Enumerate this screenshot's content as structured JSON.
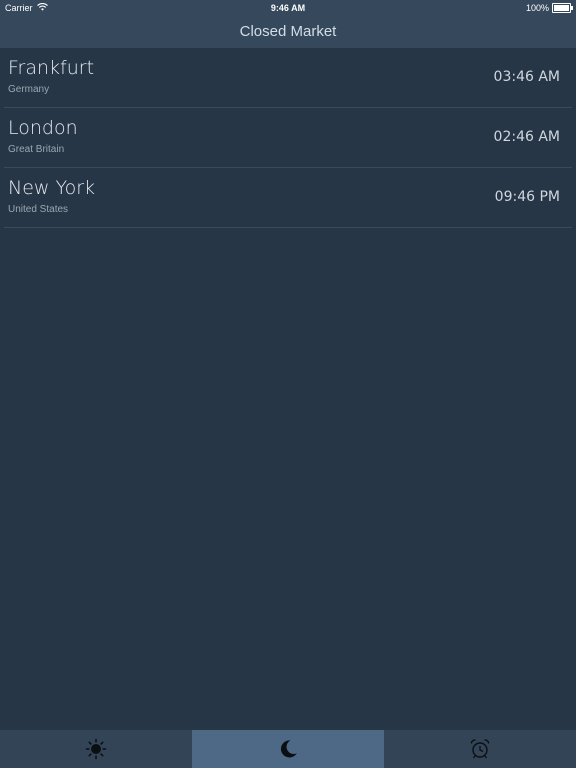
{
  "status_bar": {
    "carrier": "Carrier",
    "time": "9:46 AM",
    "battery_text": "100%"
  },
  "nav": {
    "title": "Closed Market"
  },
  "markets": [
    {
      "city": "Frankfurt",
      "country": "Germany",
      "time": "03:46 AM"
    },
    {
      "city": "London",
      "country": "Great Britain",
      "time": "02:46 AM"
    },
    {
      "city": "New York",
      "country": "United States",
      "time": "09:46 PM"
    }
  ],
  "tabs": [
    {
      "icon": "sun-icon",
      "selected": false
    },
    {
      "icon": "moon-icon",
      "selected": true
    },
    {
      "icon": "alarm-clock-icon",
      "selected": false
    }
  ],
  "colors": {
    "background": "#273646",
    "bars": "#35485c",
    "active_tab": "#4d6985"
  }
}
